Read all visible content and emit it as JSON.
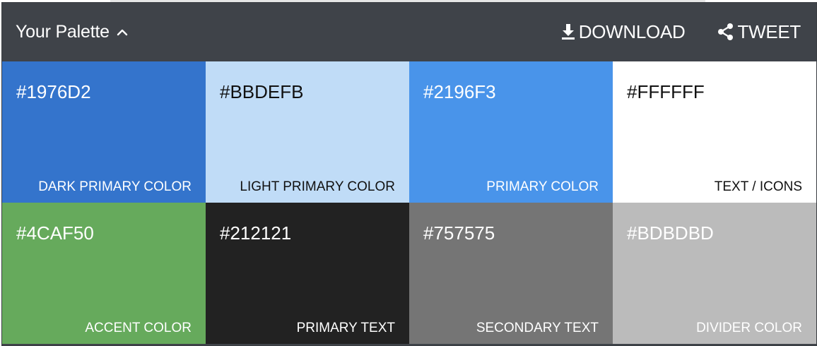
{
  "header": {
    "title": "Your Palette",
    "toggle_icon": "chevron-up-icon",
    "download_label": "DOWNLOAD",
    "download_icon": "download-icon",
    "tweet_label": "TWEET",
    "tweet_icon": "share-icon"
  },
  "swatches": [
    {
      "hex": "#1976D2",
      "label": "DARK PRIMARY COLOR",
      "bg": "#3474CC",
      "fg": "#FFFFFF"
    },
    {
      "hex": "#BBDEFB",
      "label": "LIGHT PRIMARY COLOR",
      "bg": "#C0DCF7",
      "fg": "#111111"
    },
    {
      "hex": "#2196F3",
      "label": "PRIMARY COLOR",
      "bg": "#4994EA",
      "fg": "#FFFFFF"
    },
    {
      "hex": "#FFFFFF",
      "label": "TEXT / ICONS",
      "bg": "#FFFFFF",
      "fg": "#111111"
    },
    {
      "hex": "#4CAF50",
      "label": "ACCENT COLOR",
      "bg": "#66AA5C",
      "fg": "#FFFFFF"
    },
    {
      "hex": "#212121",
      "label": "PRIMARY TEXT",
      "bg": "#222222",
      "fg": "#FFFFFF"
    },
    {
      "hex": "#757575",
      "label": "SECONDARY TEXT",
      "bg": "#757575",
      "fg": "#FFFFFF"
    },
    {
      "hex": "#BDBDBD",
      "label": "DIVIDER COLOR",
      "bg": "#BBBBBB",
      "fg": "#FFFFFF"
    }
  ]
}
